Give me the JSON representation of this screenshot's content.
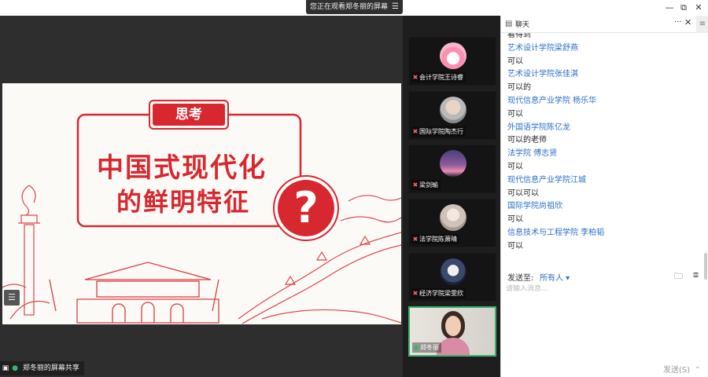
{
  "banner": {
    "text": "您正在观看郑冬丽的屏幕",
    "menu_icon": "menu-icon"
  },
  "window": {
    "minimize": "—",
    "restore": "⧉",
    "close": "✕"
  },
  "slide": {
    "badge": "思考",
    "title_line1": "中国式现代化",
    "title_line2": "的鲜明特征",
    "question": "?",
    "accent": "#d7282f"
  },
  "share_status": {
    "label": "郑冬丽的屏幕共享"
  },
  "participants": [
    {
      "name": "会计学院王诗睿",
      "avatar": "cake-avatar",
      "muted": true
    },
    {
      "name": "国际学院陶杰行",
      "avatar": "person-avatar",
      "muted": true
    },
    {
      "name": "梁剑瑜",
      "avatar": "sky-avatar",
      "muted": true
    },
    {
      "name": "法学院陈萧晴",
      "avatar": "girl-avatar",
      "muted": true
    },
    {
      "name": "经济学院梁雯欣",
      "avatar": "person-avatar",
      "muted": true
    },
    {
      "name": "郑冬丽",
      "avatar": "video",
      "muted": false,
      "active": true
    }
  ],
  "chat": {
    "title": "聊天",
    "messages": [
      {
        "type": "text",
        "value": "看得到"
      },
      {
        "type": "sender",
        "value": "艺术设计学院梁舒燕"
      },
      {
        "type": "text",
        "value": "可以"
      },
      {
        "type": "sender",
        "value": "艺术设计学院张佳淇"
      },
      {
        "type": "text",
        "value": "可以的"
      },
      {
        "type": "sender",
        "value": "现代信息产业学院 杨乐华"
      },
      {
        "type": "text",
        "value": "可以"
      },
      {
        "type": "sender",
        "value": "外国语学院陈亿龙"
      },
      {
        "type": "text",
        "value": "可以的老师"
      },
      {
        "type": "sender",
        "value": "法学院 傅志贤"
      },
      {
        "type": "text",
        "value": "可以"
      },
      {
        "type": "sender",
        "value": "现代信息产业学院江城"
      },
      {
        "type": "text",
        "value": "可以可以"
      },
      {
        "type": "sender",
        "value": "国际学院尚祖欣"
      },
      {
        "type": "text",
        "value": "可以"
      },
      {
        "type": "sender",
        "value": "信息技术与工程学院 李柏韬"
      },
      {
        "type": "text",
        "value": "可以"
      }
    ],
    "send_to_label": "发送至:",
    "send_to_value": "所有人 ▾",
    "input_placeholder": "请输入消息...",
    "send_button": "发送(S)",
    "sender_color": "#2a6fc9"
  }
}
